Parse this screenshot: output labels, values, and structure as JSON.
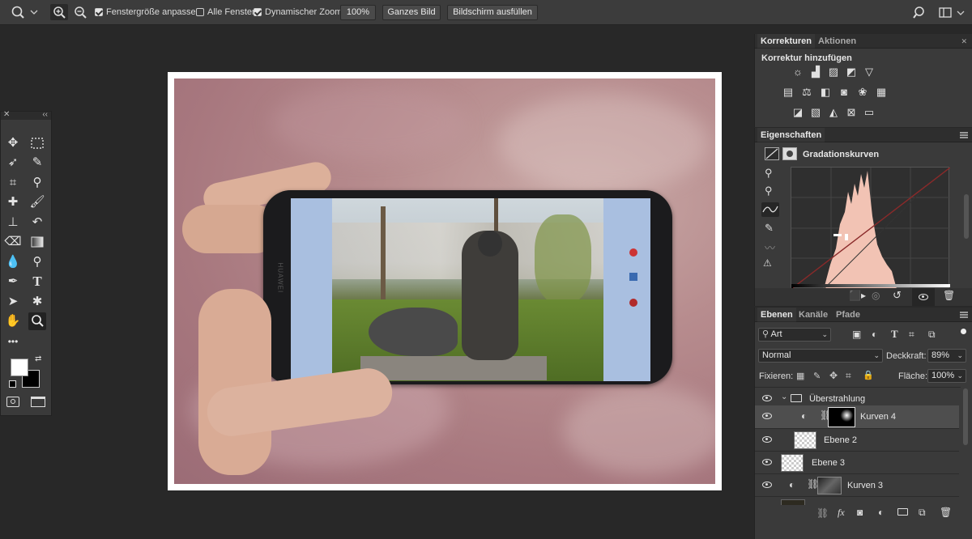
{
  "options_bar": {
    "resize_windows_label": "Fenstergröße anpassen",
    "resize_windows_checked": true,
    "all_windows_label": "Alle Fenster",
    "all_windows_checked": false,
    "scrubby_zoom_label": "Dynamischer Zoom",
    "scrubby_zoom_checked": true,
    "zoom_value": "100%",
    "fit_screen_label": "Ganzes Bild",
    "fill_screen_label": "Bildschirm ausfüllen"
  },
  "tools": {
    "active": "zoom-tool",
    "more_label": "•••"
  },
  "canvas": {
    "phone_brand": "HUAWEI"
  },
  "adjustments_panel": {
    "tabs": [
      "Korrekturen",
      "Aktionen"
    ],
    "heading": "Korrektur hinzufügen"
  },
  "properties_panel": {
    "tab": "Eigenschaften",
    "title": "Gradationskurven"
  },
  "layers_panel": {
    "tabs": [
      "Ebenen",
      "Kanäle",
      "Pfade"
    ],
    "filter_kind": "Art",
    "blend_mode": "Normal",
    "opacity_label": "Deckkraft:",
    "opacity_value": "89%",
    "lock_label": "Fixieren:",
    "fill_label": "Fläche:",
    "fill_value": "100%",
    "layers": [
      {
        "name": "Überstrahlung",
        "type": "group"
      },
      {
        "name": "Kurven 4",
        "type": "curves",
        "selected": true
      },
      {
        "name": "Ebene 2",
        "type": "pixel"
      },
      {
        "name": "Ebene 3",
        "type": "pixel"
      },
      {
        "name": "Kurven 3",
        "type": "curves"
      }
    ]
  },
  "colors": {
    "accent_histogram": "#f2c3b4",
    "panel_bg": "#3a3a3a",
    "app_bg": "#282828"
  }
}
